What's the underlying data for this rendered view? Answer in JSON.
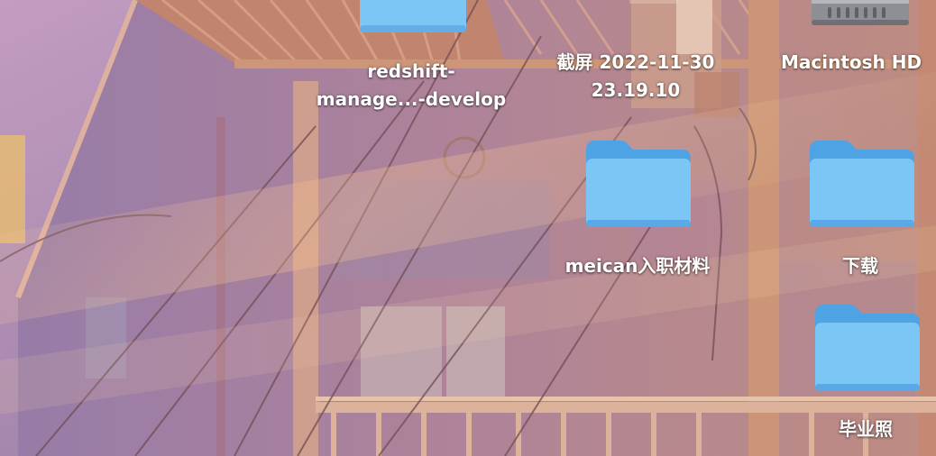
{
  "desktop": {
    "items": [
      {
        "id": "redshift",
        "kind": "folder",
        "label_lines": [
          "redshift-",
          "manage...-develop"
        ]
      },
      {
        "id": "screenshot",
        "kind": "image-file",
        "label_lines": [
          "截屏 2022-11-30",
          "23.19.10"
        ]
      },
      {
        "id": "macintosh-hd",
        "kind": "hard-drive",
        "label_lines": [
          "Macintosh HD"
        ]
      },
      {
        "id": "meican",
        "kind": "folder",
        "label_lines": [
          "meican入职材料"
        ]
      },
      {
        "id": "downloads",
        "kind": "folder",
        "label_lines": [
          "下载"
        ]
      },
      {
        "id": "graduation",
        "kind": "folder",
        "label_lines": [
          "毕业照"
        ]
      }
    ]
  },
  "colors": {
    "folder_front": "#7cc6f6",
    "folder_back": "#4ea3e4",
    "label_text": "#ffffff"
  }
}
